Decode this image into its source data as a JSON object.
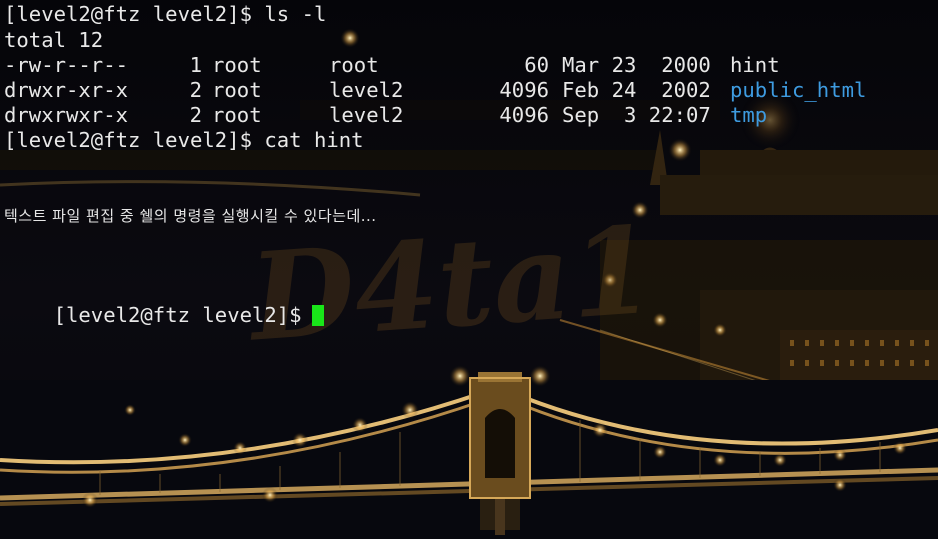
{
  "terminal": {
    "lines": {
      "cmd_ls": "[level2@ftz level2]$ ls -l",
      "total": "total 12",
      "cmd_cat": "[level2@ftz level2]$ cat hint",
      "prompt": "[level2@ftz level2]$"
    },
    "files": [
      {
        "perms": "-rw-r--r--",
        "links": "1",
        "owner": "root",
        "group": "root",
        "size": "60",
        "date": "Mar 23  2000",
        "name": "hint",
        "is_dir": false
      },
      {
        "perms": "drwxr-xr-x",
        "links": "2",
        "owner": "root",
        "group": "level2",
        "size": "4096",
        "date": "Feb 24  2002",
        "name": "public_html",
        "is_dir": true
      },
      {
        "perms": "drwxrwxr-x",
        "links": "2",
        "owner": "root",
        "group": "level2",
        "size": "4096",
        "date": "Sep  3 22:07",
        "name": "tmp",
        "is_dir": true
      }
    ],
    "hint_text": "텍스트 파일 편집 중 쉘의 명령을 실행시킬 수 있다는데...",
    "dir_color": "#3e9be0",
    "cursor_color": "#19e619"
  },
  "wallpaper": {
    "watermark_text": "D4ta1"
  }
}
